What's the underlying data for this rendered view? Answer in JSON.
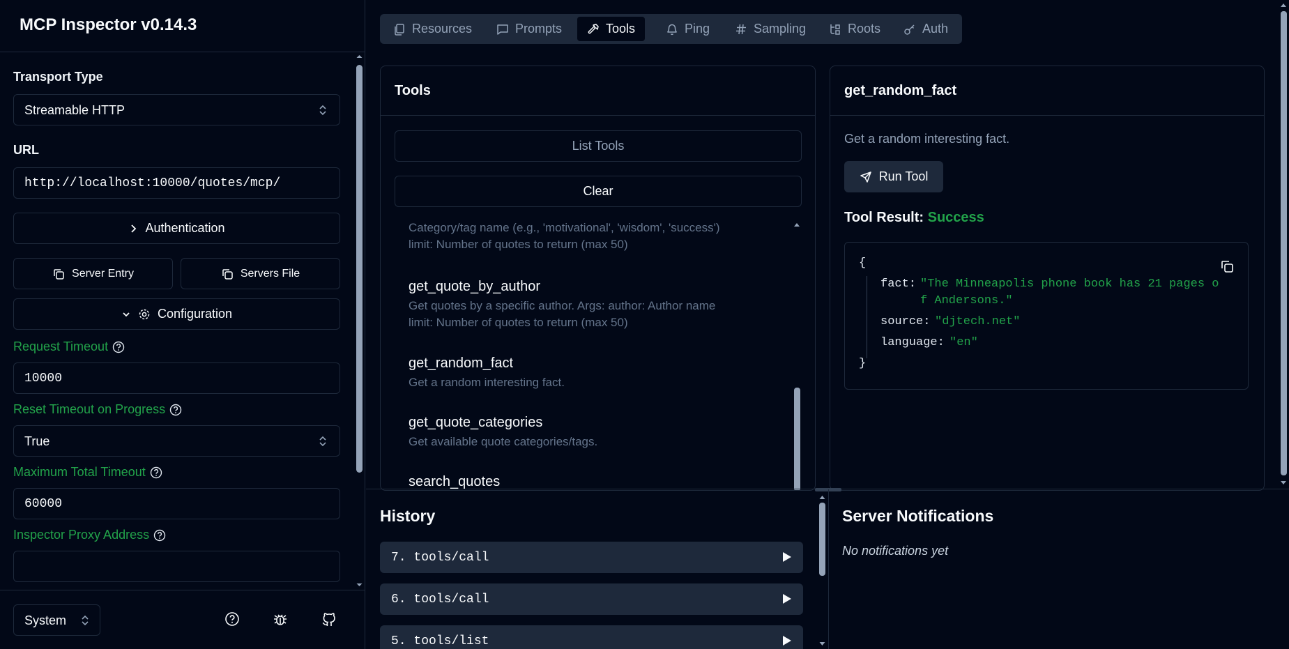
{
  "app": {
    "title": "MCP Inspector v0.14.3"
  },
  "sidebar": {
    "transport_label": "Transport Type",
    "transport_value": "Streamable HTTP",
    "url_label": "URL",
    "url_value": "http://localhost:10000/quotes/mcp/",
    "auth_button": "Authentication",
    "server_entry_button": "Server Entry",
    "servers_file_button": "Servers File",
    "configuration_button": "Configuration",
    "config": [
      {
        "label": "Request Timeout",
        "value": "10000",
        "kind": "input"
      },
      {
        "label": "Reset Timeout on Progress",
        "value": "True",
        "kind": "select"
      },
      {
        "label": "Maximum Total Timeout",
        "value": "60000",
        "kind": "input"
      },
      {
        "label": "Inspector Proxy Address",
        "value": "",
        "kind": "input"
      }
    ],
    "theme_value": "System"
  },
  "tabs": [
    {
      "label": "Resources",
      "icon": "files-icon"
    },
    {
      "label": "Prompts",
      "icon": "message-square-icon"
    },
    {
      "label": "Tools",
      "icon": "hammer-icon",
      "active": true
    },
    {
      "label": "Ping",
      "icon": "bell-icon"
    },
    {
      "label": "Sampling",
      "icon": "hash-icon"
    },
    {
      "label": "Roots",
      "icon": "folder-tree-icon"
    },
    {
      "label": "Auth",
      "icon": "key-icon"
    }
  ],
  "tools_panel": {
    "title": "Tools",
    "list_button": "List Tools",
    "clear_button": "Clear",
    "partial_lines": [
      "Category/tag name (e.g., 'motivational', 'wisdom', 'success')",
      "limit: Number of quotes to return (max 50)"
    ],
    "items": [
      {
        "name": "get_quote_by_author",
        "desc1": "Get quotes by a specific author. Args: author: Author name",
        "desc2": "limit: Number of quotes to return (max 50)"
      },
      {
        "name": "get_random_fact",
        "desc1": "Get a random interesting fact.",
        "desc2": ""
      },
      {
        "name": "get_quote_categories",
        "desc1": "Get available quote categories/tags.",
        "desc2": ""
      },
      {
        "name": "search_quotes",
        "desc1": "",
        "desc2": ""
      }
    ]
  },
  "detail_panel": {
    "title": "get_random_fact",
    "description": "Get a random interesting fact.",
    "run_button": "Run Tool",
    "result_label": "Tool Result:",
    "result_status": "Success",
    "result": {
      "open": "{",
      "close": "}",
      "fact_key": "fact:",
      "fact_line1": "\"The Minneapolis phone book has 21 pages o",
      "fact_line2": "f Andersons.\"",
      "source_key": "source:",
      "source_val": "\"djtech.net\"",
      "language_key": "language:",
      "language_val": "\"en\""
    }
  },
  "history": {
    "title": "History",
    "items": [
      "7. tools/call",
      "6. tools/call",
      "5. tools/list"
    ]
  },
  "notifications": {
    "title": "Server Notifications",
    "empty": "No notifications yet"
  },
  "colors": {
    "background": "#020817",
    "border": "#1e293b",
    "accent_green": "#22a34a",
    "muted": "#64748b"
  }
}
